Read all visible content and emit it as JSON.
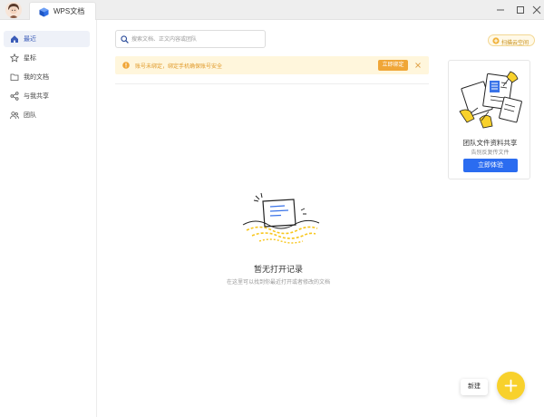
{
  "titlebar": {
    "tab_label": "WPS文档",
    "window_controls": [
      "minimize-icon",
      "maximize-icon",
      "close-icon"
    ]
  },
  "sidebar": {
    "items": [
      {
        "label": "最近",
        "icon": "home-icon",
        "active": true
      },
      {
        "label": "星标",
        "icon": "star-icon",
        "active": false
      },
      {
        "label": "我的文档",
        "icon": "folder-icon",
        "active": false
      },
      {
        "label": "与我共享",
        "icon": "share-icon",
        "active": false
      },
      {
        "label": "团队",
        "icon": "team-icon",
        "active": false
      }
    ]
  },
  "search": {
    "placeholder": "搜索文档、正文内容或团队",
    "value": ""
  },
  "top_action": {
    "label": "扫描云空间"
  },
  "warning": {
    "text": "账号未绑定，绑定手机确保账号安全",
    "button_label": "立即绑定"
  },
  "promo": {
    "title": "团队文件资料共享",
    "subtitle": "告别反复传文件",
    "button_label": "立即体验"
  },
  "empty_state": {
    "title": "暂无打开记录",
    "subtitle": "在这里可以找到你最近打开或者修改的文档"
  },
  "new_button": {
    "label": "新建"
  },
  "colors": {
    "accent": "#2b6cf0",
    "fab": "#f8d12c",
    "warning_bg": "#fff6dc",
    "warning_text": "#e09a2a",
    "warning_button": "#f0a637"
  }
}
